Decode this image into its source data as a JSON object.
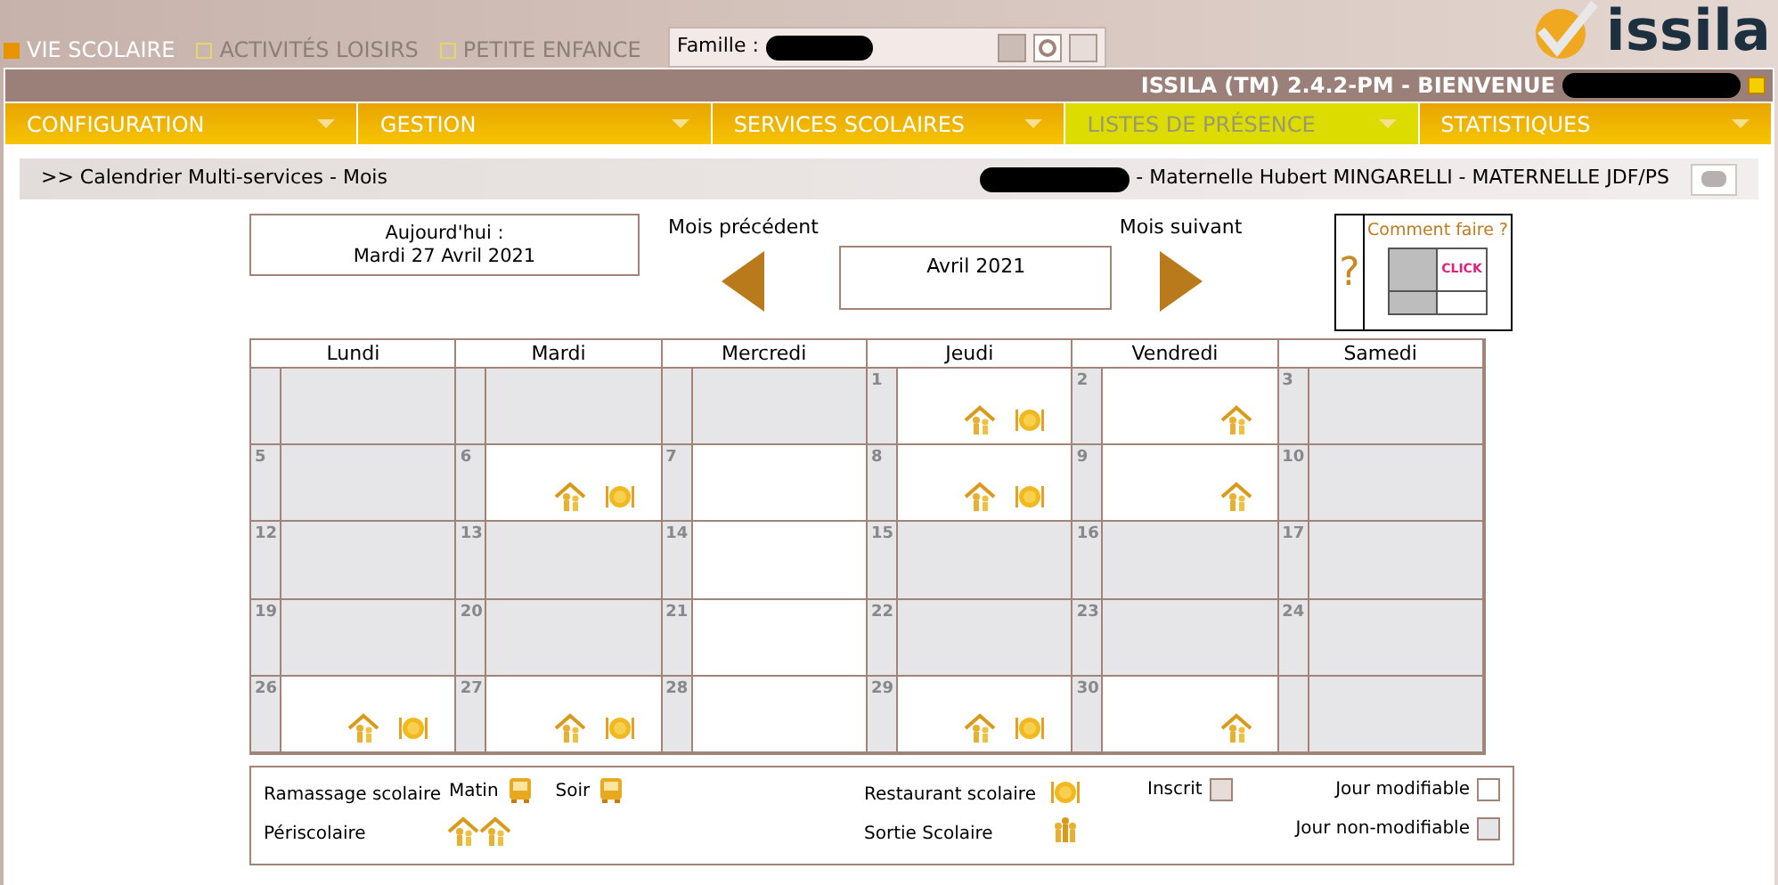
{
  "module_tabs": [
    {
      "label": "VIE SCOLAIRE",
      "selected": true
    },
    {
      "label": "ACTIVITÉS LOISIRS",
      "selected": false
    },
    {
      "label": "PETITE ENFANCE",
      "selected": false
    }
  ],
  "family": {
    "label": "Famille :"
  },
  "logo": {
    "text": "issila"
  },
  "header": {
    "title": "ISSILA (TM) 2.4.2-PM - BIENVENUE",
    "checked": true
  },
  "menu": [
    {
      "label": "CONFIGURATION",
      "selected": false
    },
    {
      "label": "GESTION",
      "selected": false
    },
    {
      "label": "SERVICES SCOLAIRES",
      "selected": false
    },
    {
      "label": "LISTES DE PRÉSENCE",
      "selected": true
    },
    {
      "label": "STATISTIQUES",
      "selected": false
    }
  ],
  "breadcrumb": {
    "path": ">> Calendrier Multi-services - Mois",
    "school": "- Maternelle Hubert MINGARELLI - MATERNELLE JDF/PS"
  },
  "today": {
    "label": "Aujourd'hui :",
    "date": "Mardi 27 Avril 2021"
  },
  "nav": {
    "previous": "Mois précédent",
    "current": "Avril 2021",
    "next": "Mois suivant"
  },
  "help": {
    "mark": "?",
    "label": "Comment faire ?",
    "click": "CLICK"
  },
  "calendar": {
    "days": [
      "Lundi",
      "Mardi",
      "Mercredi",
      "Jeudi",
      "Vendredi",
      "Samedi"
    ],
    "weeks": [
      [
        {
          "modifiable": false
        },
        {
          "modifiable": false
        },
        {
          "modifiable": false
        },
        {
          "day": "1",
          "modifiable": true,
          "periscolaire": true,
          "restaurant": true
        },
        {
          "day": "2",
          "modifiable": true,
          "periscolaire": true
        },
        {
          "day": "3",
          "modifiable": false
        }
      ],
      [
        {
          "day": "5",
          "modifiable": false
        },
        {
          "day": "6",
          "modifiable": true,
          "periscolaire": true,
          "restaurant": true
        },
        {
          "day": "7",
          "modifiable": true
        },
        {
          "day": "8",
          "modifiable": true,
          "periscolaire": true,
          "restaurant": true
        },
        {
          "day": "9",
          "modifiable": true,
          "periscolaire": true
        },
        {
          "day": "10",
          "modifiable": false
        }
      ],
      [
        {
          "day": "12",
          "modifiable": false
        },
        {
          "day": "13",
          "modifiable": false
        },
        {
          "day": "14",
          "modifiable": true
        },
        {
          "day": "15",
          "modifiable": false
        },
        {
          "day": "16",
          "modifiable": false
        },
        {
          "day": "17",
          "modifiable": false
        }
      ],
      [
        {
          "day": "19",
          "modifiable": false
        },
        {
          "day": "20",
          "modifiable": false
        },
        {
          "day": "21",
          "modifiable": true
        },
        {
          "day": "22",
          "modifiable": false
        },
        {
          "day": "23",
          "modifiable": false
        },
        {
          "day": "24",
          "modifiable": false
        }
      ],
      [
        {
          "day": "26",
          "modifiable": true,
          "periscolaire": true,
          "restaurant": true
        },
        {
          "day": "27",
          "modifiable": true,
          "periscolaire": true,
          "restaurant": true
        },
        {
          "day": "28",
          "modifiable": true
        },
        {
          "day": "29",
          "modifiable": true,
          "periscolaire": true,
          "restaurant": true
        },
        {
          "day": "30",
          "modifiable": true,
          "periscolaire": true
        },
        {
          "modifiable": false
        }
      ]
    ]
  },
  "legend": {
    "ramassage": "Ramassage scolaire",
    "matin": "Matin",
    "soir": "Soir",
    "periscolaire": "Périscolaire",
    "restaurant": "Restaurant scolaire",
    "sortie": "Sortie Scolaire",
    "inscrit": "Inscrit",
    "modifiable": "Jour modifiable",
    "non_modifiable": "Jour non-modifiable"
  }
}
